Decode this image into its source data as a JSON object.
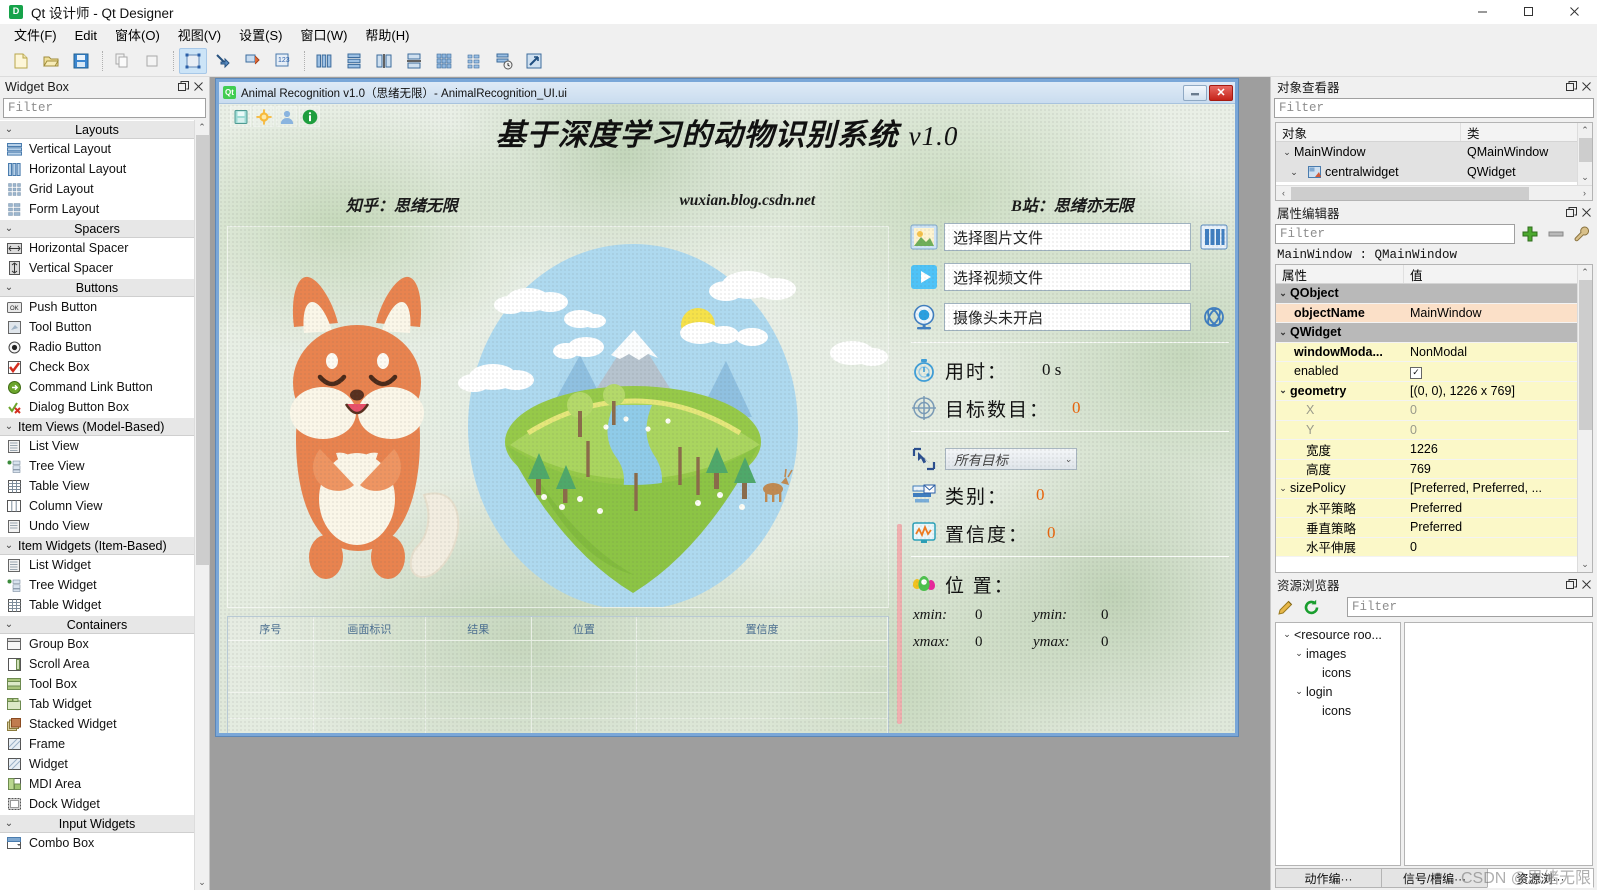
{
  "window": {
    "title": "Qt 设计师 - Qt Designer",
    "app_icon": "qt-designer-icon",
    "minimize": "−",
    "maximize": "□",
    "close": "✕"
  },
  "menubar": {
    "items": [
      {
        "label": "文件(F)",
        "name": "menu-file"
      },
      {
        "label": "Edit",
        "name": "menu-edit"
      },
      {
        "label": "窗体(O)",
        "name": "menu-form"
      },
      {
        "label": "视图(V)",
        "name": "menu-view"
      },
      {
        "label": "设置(S)",
        "name": "menu-settings"
      },
      {
        "label": "窗口(W)",
        "name": "menu-window"
      },
      {
        "label": "帮助(H)",
        "name": "menu-help"
      }
    ]
  },
  "toolbar": {
    "buttons": [
      {
        "name": "new-form-icon",
        "tip": "新建"
      },
      {
        "name": "open-folder-icon",
        "tip": "打开"
      },
      {
        "name": "save-icon",
        "tip": "保存"
      },
      {
        "name": "copy-icon",
        "tip": "复制"
      },
      {
        "name": "paste-icon",
        "tip": "粘贴"
      },
      {
        "name": "edit-widgets-icon",
        "tip": "编辑控件"
      },
      {
        "name": "edit-signals-slots-icon",
        "tip": "编辑信号/槽"
      },
      {
        "name": "edit-buddies-icon",
        "tip": "编辑伙伴"
      },
      {
        "name": "edit-tab-order-icon",
        "tip": "编辑Tab顺序"
      },
      {
        "name": "layout-horizontal-icon",
        "tip": "水平布局"
      },
      {
        "name": "layout-vertical-icon",
        "tip": "垂直布局"
      },
      {
        "name": "layout-splitter-h-icon",
        "tip": "水平分裂器布局"
      },
      {
        "name": "layout-splitter-v-icon",
        "tip": "垂直分裂器布局"
      },
      {
        "name": "layout-grid-icon",
        "tip": "栅格布局"
      },
      {
        "name": "layout-form-icon",
        "tip": "表单布局"
      },
      {
        "name": "break-layout-icon",
        "tip": "打破布局"
      },
      {
        "name": "adjust-size-icon",
        "tip": "调整大小"
      }
    ]
  },
  "widget_box": {
    "title": "Widget Box",
    "filter_placeholder": "Filter",
    "float_icon": "undock-icon",
    "close_icon": "close-icon",
    "groups": [
      {
        "label": "Layouts",
        "items": [
          {
            "label": "Vertical Layout",
            "icon": "vertical-layout-icon"
          },
          {
            "label": "Horizontal Layout",
            "icon": "horizontal-layout-icon"
          },
          {
            "label": "Grid Layout",
            "icon": "grid-layout-icon"
          },
          {
            "label": "Form Layout",
            "icon": "form-layout-icon"
          }
        ]
      },
      {
        "label": "Spacers",
        "items": [
          {
            "label": "Horizontal Spacer",
            "icon": "horizontal-spacer-icon"
          },
          {
            "label": "Vertical Spacer",
            "icon": "vertical-spacer-icon"
          }
        ]
      },
      {
        "label": "Buttons",
        "items": [
          {
            "label": "Push Button",
            "icon": "push-button-icon"
          },
          {
            "label": "Tool Button",
            "icon": "tool-button-icon"
          },
          {
            "label": "Radio Button",
            "icon": "radio-button-icon"
          },
          {
            "label": "Check Box",
            "icon": "check-box-icon"
          },
          {
            "label": "Command Link Button",
            "icon": "command-link-button-icon"
          },
          {
            "label": "Dialog Button Box",
            "icon": "dialog-button-box-icon"
          }
        ]
      },
      {
        "label": "Item Views (Model-Based)",
        "left_aligned": true,
        "items": [
          {
            "label": "List View",
            "icon": "list-view-icon"
          },
          {
            "label": "Tree View",
            "icon": "tree-view-icon"
          },
          {
            "label": "Table View",
            "icon": "table-view-icon"
          },
          {
            "label": "Column View",
            "icon": "column-view-icon"
          },
          {
            "label": "Undo View",
            "icon": "undo-view-icon"
          }
        ]
      },
      {
        "label": "Item Widgets (Item-Based)",
        "left_aligned": true,
        "items": [
          {
            "label": "List Widget",
            "icon": "list-widget-icon"
          },
          {
            "label": "Tree Widget",
            "icon": "tree-widget-icon"
          },
          {
            "label": "Table Widget",
            "icon": "table-widget-icon"
          }
        ]
      },
      {
        "label": "Containers",
        "items": [
          {
            "label": "Group Box",
            "icon": "group-box-icon"
          },
          {
            "label": "Scroll Area",
            "icon": "scroll-area-icon"
          },
          {
            "label": "Tool Box",
            "icon": "tool-box-icon"
          },
          {
            "label": "Tab Widget",
            "icon": "tab-widget-icon"
          },
          {
            "label": "Stacked Widget",
            "icon": "stacked-widget-icon"
          },
          {
            "label": "Frame",
            "icon": "frame-icon"
          },
          {
            "label": "Widget",
            "icon": "widget-icon"
          },
          {
            "label": "MDI Area",
            "icon": "mdi-area-icon"
          },
          {
            "label": "Dock Widget",
            "icon": "dock-widget-icon"
          }
        ]
      },
      {
        "label": "Input Widgets",
        "items": [
          {
            "label": "Combo Box",
            "icon": "combo-box-icon"
          }
        ]
      }
    ]
  },
  "form": {
    "titlebar": {
      "icon": "qt-icon",
      "text": "Animal Recognition v1.0（思绪无限）- AnimalRecognition_UI.ui",
      "minimize": "—",
      "close": "✕"
    },
    "header_icons": [
      {
        "name": "save-icon"
      },
      {
        "name": "settings-icon"
      },
      {
        "name": "user-icon"
      },
      {
        "name": "info-icon"
      }
    ],
    "title": "基于深度学习的动物识别系统",
    "version": "v1.0",
    "subtitles": {
      "left": "知乎：思绪无限",
      "center": "wuxian.blog.csdn.net",
      "right": "B站：思绪亦无限"
    },
    "preview_image": "dog-and-landscape-illustration",
    "table": {
      "headers": [
        "序号",
        "画面标识",
        "结果",
        "位置",
        "置信度"
      ],
      "rows": [
        [
          "",
          "",
          "",
          "",
          ""
        ],
        [
          "",
          "",
          "",
          "",
          ""
        ],
        [
          "",
          "",
          "",
          "",
          ""
        ],
        [
          "",
          "",
          "",
          "",
          ""
        ]
      ]
    },
    "controls": {
      "image_input": {
        "value": "选择图片文件",
        "icon": "image-file-icon",
        "action_icon": "model-columns-icon"
      },
      "video_input": {
        "value": "选择视频文件",
        "icon": "video-play-icon"
      },
      "camera_input": {
        "value": "摄像头未开启",
        "icon": "webcam-icon",
        "action_icon": "network-icon"
      }
    },
    "stats": [
      {
        "icon": "stopwatch-icon",
        "label": "用时：",
        "value": "0 s",
        "color": "#111111"
      },
      {
        "icon": "target-icon",
        "label": "目标数目：",
        "value": "0",
        "color": "#e8630a"
      }
    ],
    "target_select": {
      "icon": "select-pointer-icon",
      "value": "所有目标",
      "arrow": "⌄"
    },
    "details": [
      {
        "icon": "category-icon",
        "label": "类别：",
        "value": "0",
        "color": "#e8630a"
      },
      {
        "icon": "confidence-chart-icon",
        "label": "置信度：",
        "value": "0",
        "color": "#e8630a"
      }
    ],
    "position": {
      "icon": "location-pin-icon",
      "label": "位 置：",
      "fields": [
        {
          "key": "xmin:",
          "value": "0"
        },
        {
          "key": "ymin:",
          "value": "0"
        },
        {
          "key": "xmax:",
          "value": "0"
        },
        {
          "key": "ymax:",
          "value": "0"
        }
      ]
    }
  },
  "object_inspector": {
    "title": "对象查看器",
    "filter_placeholder": "Filter",
    "float_icon": "undock-icon",
    "close_icon": "close-icon",
    "headers": [
      "对象",
      "类"
    ],
    "rows": [
      {
        "name": "MainWindow",
        "class": "QMainWindow",
        "depth": 0,
        "expanded": true,
        "icon": "",
        "selected": true
      },
      {
        "name": "centralwidget",
        "class": "QWidget",
        "depth": 1,
        "expanded": true,
        "icon": "widget-icon",
        "selected": true
      }
    ]
  },
  "property_editor": {
    "title": "属性编辑器",
    "filter_placeholder": "Filter",
    "float_icon": "undock-icon",
    "close_icon": "close-icon",
    "add_icon": "add-icon",
    "remove_icon": "remove-icon",
    "configure_icon": "wrench-icon",
    "object_line": "MainWindow : QMainWindow",
    "headers": [
      "属性",
      "值"
    ],
    "rows": [
      {
        "name": "QObject",
        "value": "",
        "type": "group",
        "depth": 0,
        "expanded": true
      },
      {
        "name": "objectName",
        "value": "MainWindow",
        "type": "peach",
        "depth": 1,
        "bold": true
      },
      {
        "name": "QWidget",
        "value": "",
        "type": "group",
        "depth": 0,
        "expanded": true
      },
      {
        "name": "windowModa...",
        "value": "NonModal",
        "type": "yellow",
        "depth": 1,
        "bold": true
      },
      {
        "name": "enabled",
        "value": "checkbox",
        "type": "yellow",
        "depth": 1,
        "bold": false
      },
      {
        "name": "geometry",
        "value": "[(0, 0), 1226 x 769]",
        "type": "yellow",
        "depth": 0,
        "bold": true,
        "expanded": true
      },
      {
        "name": "X",
        "value": "0",
        "type": "yellow",
        "depth": 2,
        "dim": true
      },
      {
        "name": "Y",
        "value": "0",
        "type": "yellow",
        "depth": 2,
        "dim": true
      },
      {
        "name": "宽度",
        "value": "1226",
        "type": "yellow",
        "depth": 2
      },
      {
        "name": "高度",
        "value": "769",
        "type": "yellow",
        "depth": 2
      },
      {
        "name": "sizePolicy",
        "value": "[Preferred, Preferred, ...",
        "type": "yellow",
        "depth": 0,
        "expanded": true
      },
      {
        "name": "水平策略",
        "value": "Preferred",
        "type": "yellow",
        "depth": 2
      },
      {
        "name": "垂直策略",
        "value": "Preferred",
        "type": "yellow",
        "depth": 2
      },
      {
        "name": "水平伸展",
        "value": "0",
        "type": "yellow",
        "depth": 2
      }
    ]
  },
  "resource_browser": {
    "title": "资源浏览器",
    "filter_placeholder": "Filter",
    "float_icon": "undock-icon",
    "close_icon": "close-icon",
    "edit_icon": "pencil-icon",
    "reload_icon": "reload-icon",
    "tree": [
      {
        "label": "<resource roo...",
        "depth": 0,
        "expanded": true
      },
      {
        "label": "images",
        "depth": 1,
        "expanded": true
      },
      {
        "label": "icons",
        "depth": 2,
        "expanded": false
      },
      {
        "label": "login",
        "depth": 1,
        "expanded": true
      },
      {
        "label": "icons",
        "depth": 2,
        "expanded": false
      }
    ]
  },
  "bottom_tabs": {
    "tabs": [
      {
        "label": "动作编···",
        "active": false
      },
      {
        "label": "信号/槽编···",
        "active": false
      },
      {
        "label": "资源浏···",
        "active": true
      }
    ]
  },
  "watermark": "CSDN @思绪无限",
  "colors": {
    "accent_orange": "#e8630a",
    "qt_green": "#41cd52",
    "selection_blue": "#cce4f7",
    "form_border": "#7aa7d8"
  }
}
